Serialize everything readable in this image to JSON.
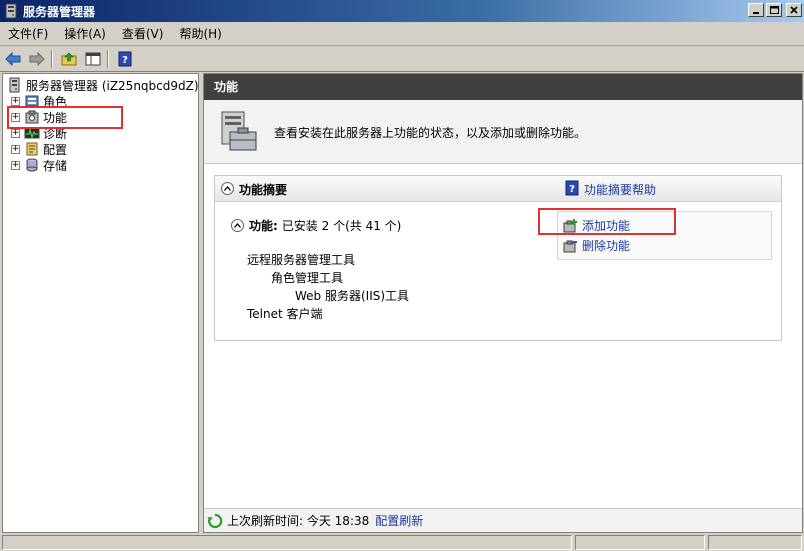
{
  "window": {
    "title": "服务器管理器"
  },
  "menu": [
    {
      "label": "文件(F)"
    },
    {
      "label": "操作(A)"
    },
    {
      "label": "查看(V)"
    },
    {
      "label": "帮助(H)"
    }
  ],
  "tree": {
    "root": "服务器管理器 (iZ25nqbcd9dZ)",
    "items": [
      {
        "label": "角色",
        "icon": "roles-icon"
      },
      {
        "label": "功能",
        "icon": "features-icon"
      },
      {
        "label": "诊断",
        "icon": "diagnostics-icon"
      },
      {
        "label": "配置",
        "icon": "configuration-icon"
      },
      {
        "label": "存储",
        "icon": "storage-icon"
      }
    ]
  },
  "content": {
    "header": "功能",
    "description": "查看安装在此服务器上功能的状态，以及添加或删除功能。",
    "summary": {
      "title": "功能摘要",
      "help_link": "功能摘要帮助",
      "features_label": "功能:",
      "features_status": "已安装 2 个(共 41 个)",
      "installed": [
        "远程服务器管理工具",
        "角色管理工具",
        "Web 服务器(IIS)工具",
        "Telnet 客户端"
      ],
      "actions": {
        "add": "添加功能",
        "remove": "删除功能"
      }
    },
    "footer": {
      "last_refresh": "上次刷新时间: 今天 18:38",
      "configure_refresh": "配置刷新"
    }
  },
  "colors": {
    "link": "#1a3a9a",
    "highlight": "#e03030",
    "header_bg": "#404040"
  }
}
